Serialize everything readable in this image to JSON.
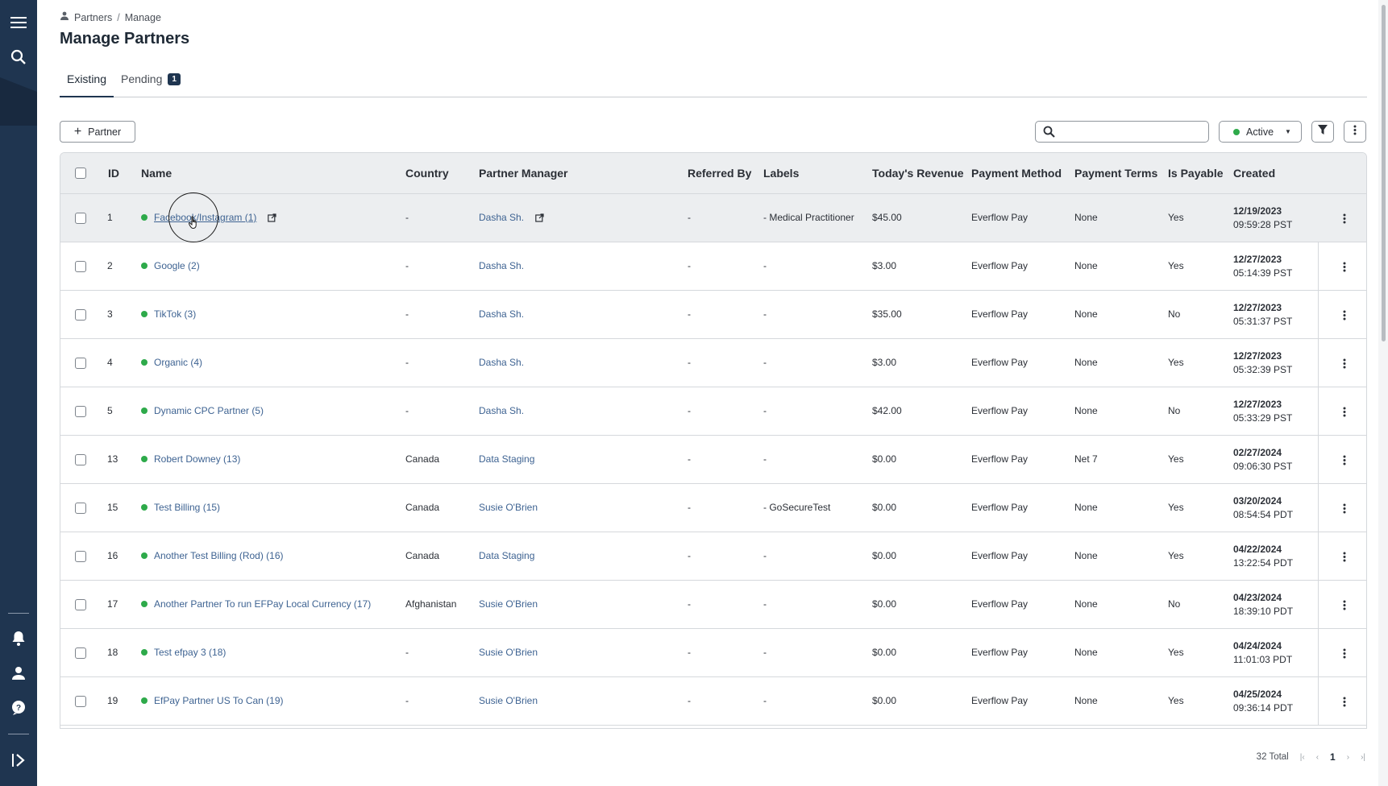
{
  "breadcrumb": {
    "root": "Partners",
    "separator": "/",
    "current": "Manage"
  },
  "page": {
    "title": "Manage Partners"
  },
  "tabs": [
    {
      "label": "Existing",
      "active": true
    },
    {
      "label": "Pending",
      "badge": "1"
    }
  ],
  "toolbar": {
    "add_label": "Partner",
    "search_placeholder": "",
    "status_value": "Active",
    "status_color": "#2eaa4a"
  },
  "columns": {
    "id": "ID",
    "name": "Name",
    "country": "Country",
    "partner_manager": "Partner Manager",
    "referred_by": "Referred By",
    "labels": "Labels",
    "todays_revenue": "Today's Revenue",
    "payment_method": "Payment Method",
    "payment_terms": "Payment Terms",
    "is_payable": "Is Payable",
    "created": "Created"
  },
  "rows": [
    {
      "id": "1",
      "name": "Facebook/Instagram (1)",
      "country": "-",
      "manager": "Dasha Sh.",
      "referred": "-",
      "labels": "- Medical Practitioner",
      "revenue": "$45.00",
      "method": "Everflow Pay",
      "terms": "None",
      "payable": "Yes",
      "date": "12/19/2023",
      "time": "09:59:28 PST"
    },
    {
      "id": "2",
      "name": "Google (2)",
      "country": "-",
      "manager": "Dasha Sh.",
      "referred": "-",
      "labels": "-",
      "revenue": "$3.00",
      "method": "Everflow Pay",
      "terms": "None",
      "payable": "Yes",
      "date": "12/27/2023",
      "time": "05:14:39 PST"
    },
    {
      "id": "3",
      "name": "TikTok (3)",
      "country": "-",
      "manager": "Dasha Sh.",
      "referred": "-",
      "labels": "-",
      "revenue": "$35.00",
      "method": "Everflow Pay",
      "terms": "None",
      "payable": "No",
      "date": "12/27/2023",
      "time": "05:31:37 PST"
    },
    {
      "id": "4",
      "name": "Organic (4)",
      "country": "-",
      "manager": "Dasha Sh.",
      "referred": "-",
      "labels": "-",
      "revenue": "$3.00",
      "method": "Everflow Pay",
      "terms": "None",
      "payable": "Yes",
      "date": "12/27/2023",
      "time": "05:32:39 PST"
    },
    {
      "id": "5",
      "name": "Dynamic CPC Partner (5)",
      "country": "-",
      "manager": "Dasha Sh.",
      "referred": "-",
      "labels": "-",
      "revenue": "$42.00",
      "method": "Everflow Pay",
      "terms": "None",
      "payable": "No",
      "date": "12/27/2023",
      "time": "05:33:29 PST"
    },
    {
      "id": "13",
      "name": "Robert Downey (13)",
      "country": "Canada",
      "manager": "Data Staging",
      "referred": "-",
      "labels": "-",
      "revenue": "$0.00",
      "method": "Everflow Pay",
      "terms": "Net 7",
      "payable": "Yes",
      "date": "02/27/2024",
      "time": "09:06:30 PST"
    },
    {
      "id": "15",
      "name": "Test Billing (15)",
      "country": "Canada",
      "manager": "Susie O'Brien",
      "referred": "-",
      "labels": "- GoSecureTest",
      "revenue": "$0.00",
      "method": "Everflow Pay",
      "terms": "None",
      "payable": "Yes",
      "date": "03/20/2024",
      "time": "08:54:54 PDT"
    },
    {
      "id": "16",
      "name": "Another Test Billing (Rod) (16)",
      "country": "Canada",
      "manager": "Data Staging",
      "referred": "-",
      "labels": "-",
      "revenue": "$0.00",
      "method": "Everflow Pay",
      "terms": "None",
      "payable": "Yes",
      "date": "04/22/2024",
      "time": "13:22:54 PDT"
    },
    {
      "id": "17",
      "name": "Another Partner To run EFPay Local Currency (17)",
      "country": "Afghanistan",
      "manager": "Susie O'Brien",
      "referred": "-",
      "labels": "-",
      "revenue": "$0.00",
      "method": "Everflow Pay",
      "terms": "None",
      "payable": "No",
      "date": "04/23/2024",
      "time": "18:39:10 PDT"
    },
    {
      "id": "18",
      "name": "Test efpay 3 (18)",
      "country": "-",
      "manager": "Susie O'Brien",
      "referred": "-",
      "labels": "-",
      "revenue": "$0.00",
      "method": "Everflow Pay",
      "terms": "None",
      "payable": "Yes",
      "date": "04/24/2024",
      "time": "11:01:03 PDT"
    },
    {
      "id": "19",
      "name": "EfPay Partner US To Can (19)",
      "country": "-",
      "manager": "Susie O'Brien",
      "referred": "-",
      "labels": "-",
      "revenue": "$0.00",
      "method": "Everflow Pay",
      "terms": "None",
      "payable": "Yes",
      "date": "04/25/2024",
      "time": "09:36:14 PDT"
    }
  ],
  "pagination": {
    "total": "32 Total",
    "current_page": "1"
  },
  "colors": {
    "sidebar": "#1f3550",
    "link": "#3e6392",
    "status_active": "#2eaa4a"
  },
  "icons": [
    "menu-icon",
    "search-icon",
    "bell-icon",
    "user-icon",
    "help-icon",
    "expand-sidebar-icon",
    "filter-icon",
    "kebab-icon",
    "external-link-icon",
    "partners-icon"
  ]
}
